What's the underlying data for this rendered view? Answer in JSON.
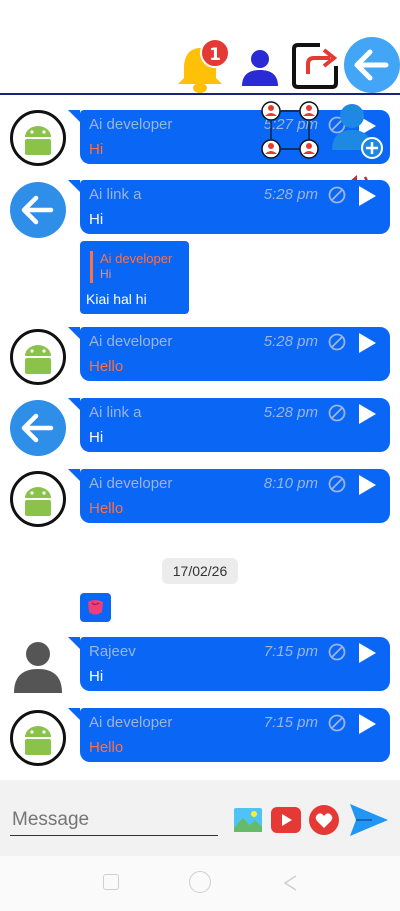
{
  "topbar": {
    "notification_count": "1",
    "icons": [
      "bell-icon",
      "person-icon",
      "share-icon",
      "back-arrow-icon"
    ]
  },
  "messages": [
    {
      "sender": "Ai developer",
      "time": "5:27 pm",
      "text": "Hi",
      "avatar": "android-icon",
      "text_color": "orange"
    },
    {
      "sender": "Ai link a",
      "time": "5:28 pm",
      "text": "Hi",
      "avatar": "back-arrow-icon",
      "text_color": "white"
    },
    {
      "sender": "Ai developer",
      "time": "5:28 pm",
      "text": "Hello",
      "avatar": "android-icon",
      "text_color": "orange"
    },
    {
      "sender": "Ai link a",
      "time": "5:28 pm",
      "text": "Hi",
      "avatar": "back-arrow-icon",
      "text_color": "white"
    },
    {
      "sender": "Ai developer",
      "time": "8:10 pm",
      "text": "Hello",
      "avatar": "android-icon",
      "text_color": "orange"
    },
    {
      "sender": "Rajeev",
      "time": "7:15 pm",
      "text": "Hi",
      "avatar": "person-icon",
      "text_color": "white"
    },
    {
      "sender": "Ai developer",
      "time": "7:15 pm",
      "text": "Hello",
      "avatar": "android-icon",
      "text_color": "orange"
    }
  ],
  "reply_card": {
    "quoted_sender": "Ai developer",
    "quoted_text": "Hi",
    "text": "Kiai hal hi"
  },
  "date_separator": "17/02/26",
  "composer": {
    "placeholder": "Message"
  },
  "colors": {
    "bubble": "#0a66f5",
    "accent": "#ff7043",
    "divider": "#1a237e"
  }
}
